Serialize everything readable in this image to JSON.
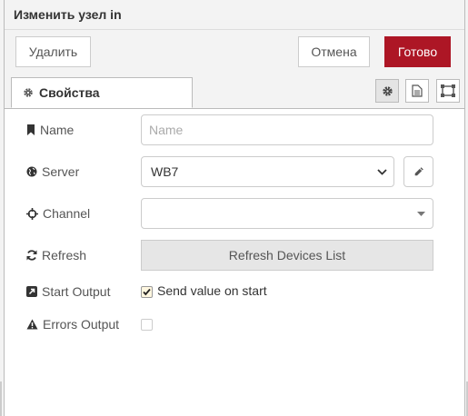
{
  "dialog": {
    "title": "Изменить узел in"
  },
  "toolbar": {
    "delete_label": "Удалить",
    "cancel_label": "Отмена",
    "done_label": "Готово"
  },
  "tabs": {
    "properties_label": "Свойства"
  },
  "form": {
    "name": {
      "label": "Name",
      "placeholder": "Name",
      "value": ""
    },
    "server": {
      "label": "Server",
      "selected": "WB7"
    },
    "channel": {
      "label": "Channel",
      "selected": ""
    },
    "refresh": {
      "label": "Refresh",
      "button_label": "Refresh Devices List"
    },
    "start_output": {
      "label": "Start Output",
      "checkbox_label": "Send value on start",
      "checked": true
    },
    "errors_output": {
      "label": "Errors Output",
      "checked": false
    }
  },
  "icons": {
    "tab": "gear-icon",
    "tab_side": [
      "gear-icon",
      "document-icon",
      "frame-icon"
    ],
    "name": "bookmark-icon",
    "server": "globe-icon",
    "channel": "crosshairs-icon",
    "refresh": "refresh-icon",
    "start_output": "share-square-icon",
    "errors_output": "warning-icon",
    "edit": "pencil-icon"
  },
  "colors": {
    "primary": "#ad1625",
    "header_bg": "#f3f3f3",
    "text": "#555555"
  }
}
